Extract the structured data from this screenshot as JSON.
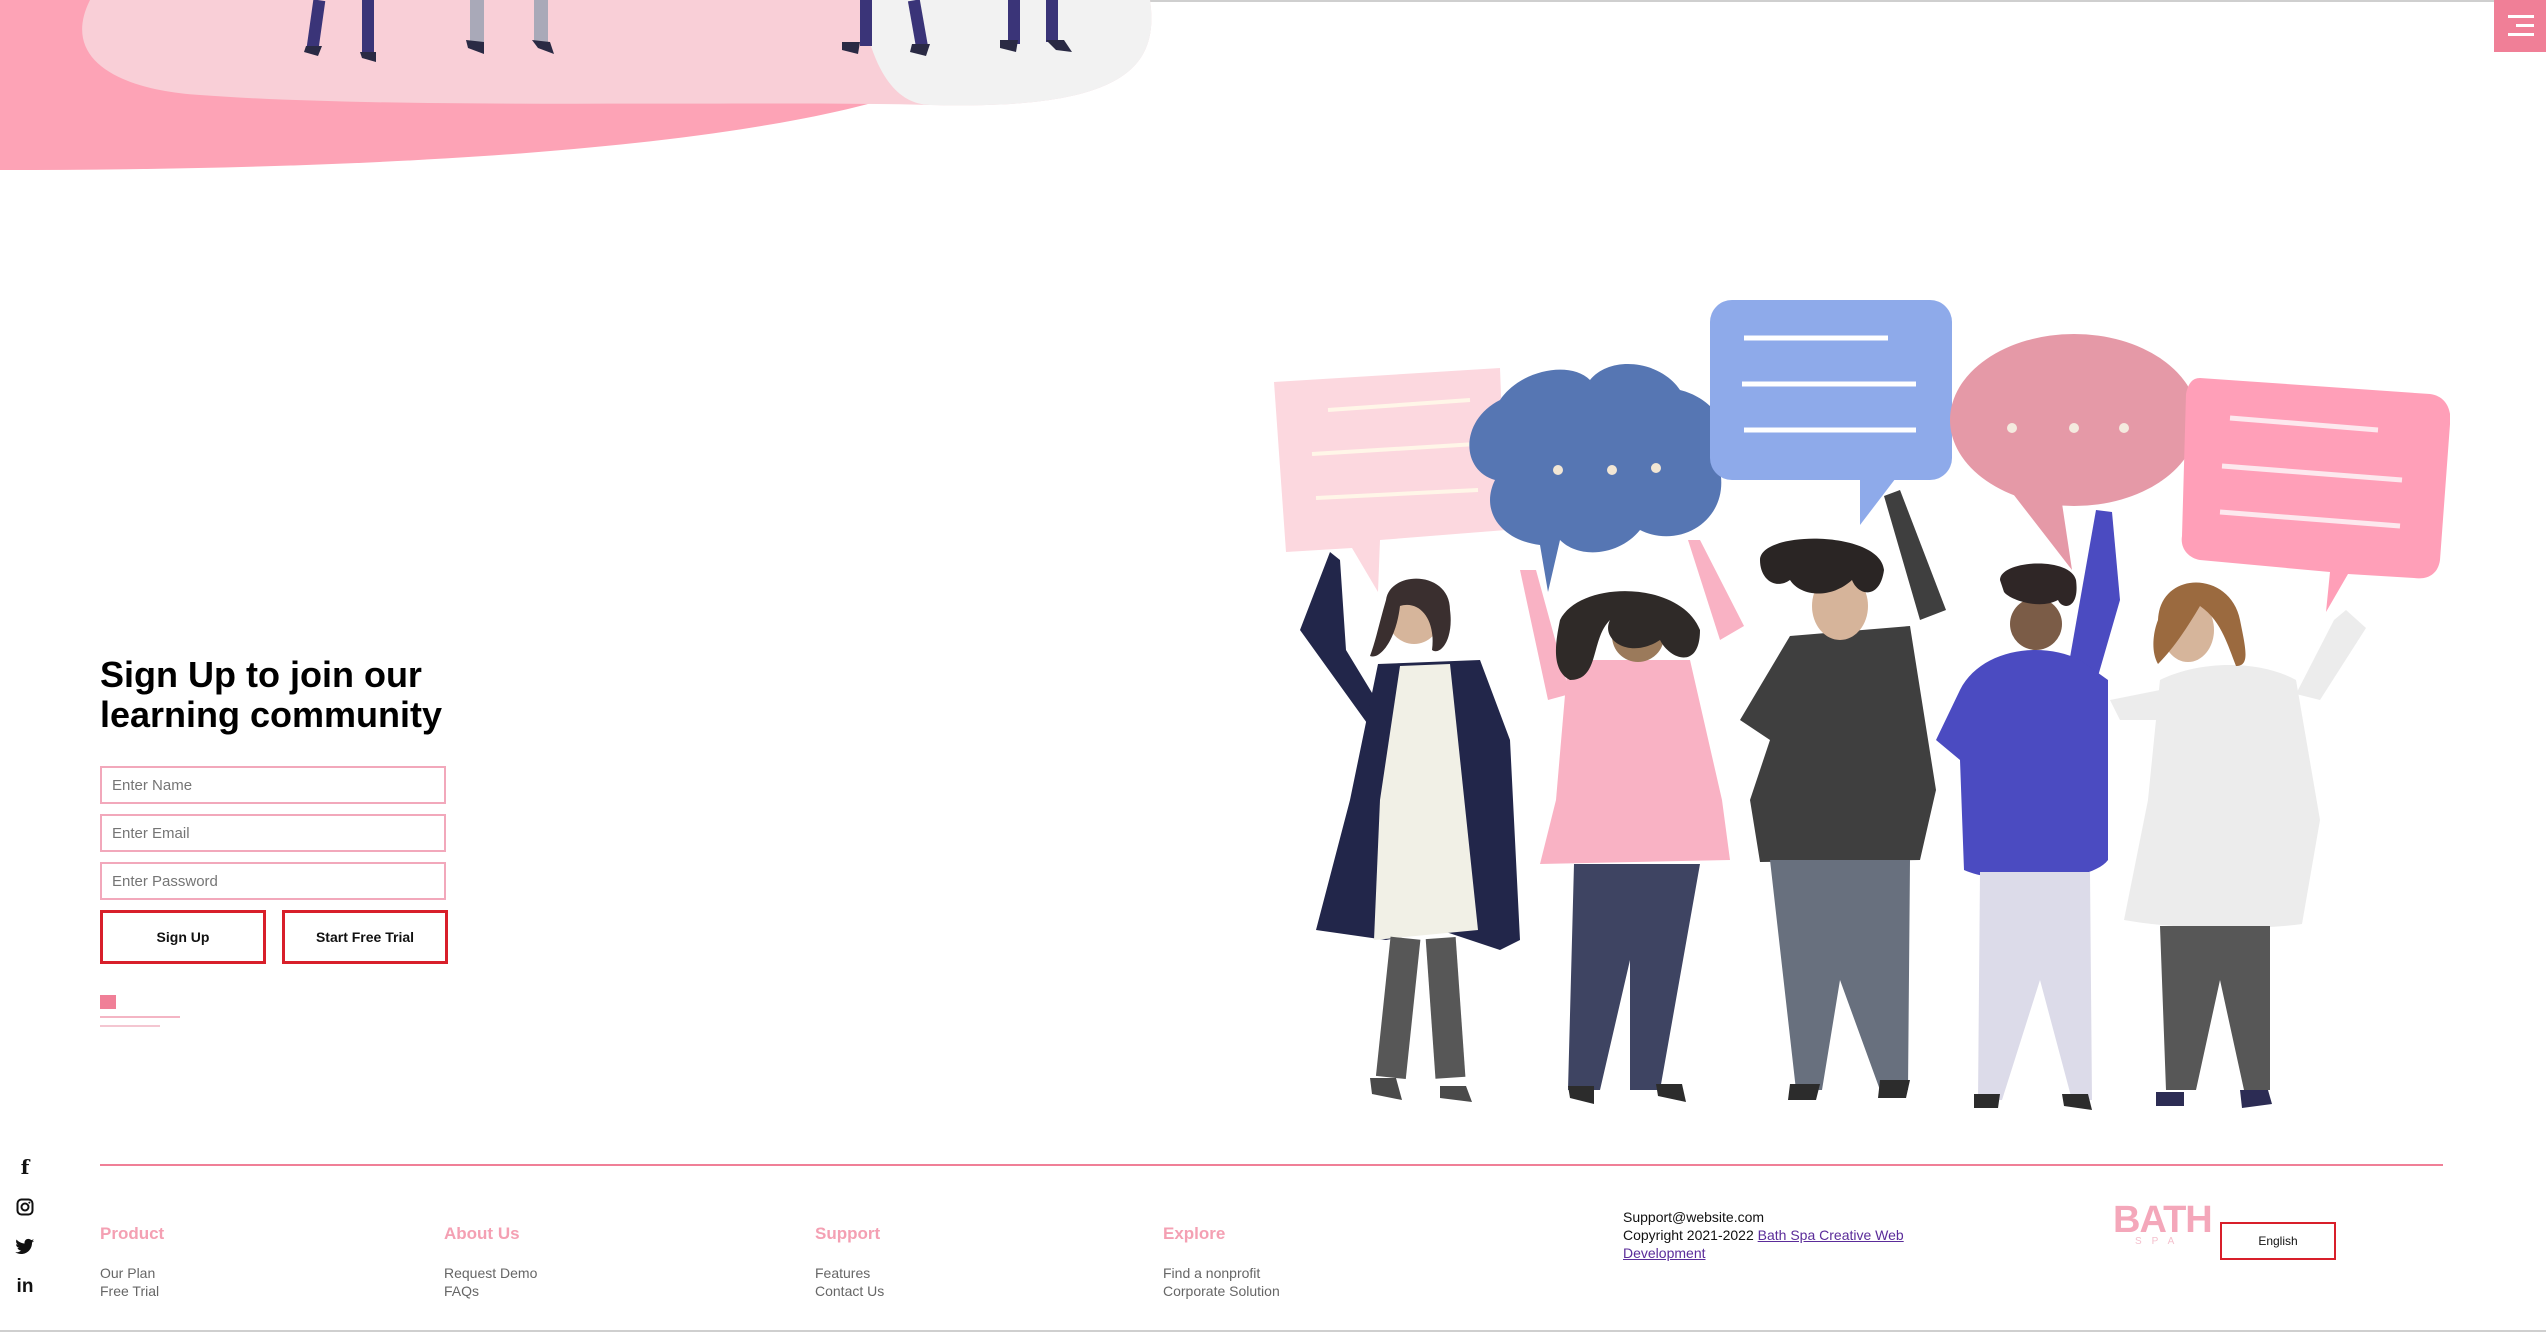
{
  "signup": {
    "title": "Sign Up to join our learning community",
    "name_placeholder": "Enter Name",
    "email_placeholder": "Enter Email",
    "password_placeholder": "Enter Password",
    "signup_label": "Sign Up",
    "trial_label": "Start Free Trial"
  },
  "social": [
    "facebook-icon",
    "instagram-icon",
    "twitter-icon",
    "linkedin-icon"
  ],
  "footer": {
    "product": {
      "heading": "Product",
      "links": [
        "Our Plan",
        "Free Trial"
      ]
    },
    "about": {
      "heading": "About Us",
      "links": [
        "Request Demo",
        "FAQs"
      ]
    },
    "support": {
      "heading": "Support",
      "links": [
        "Features",
        "Contact Us"
      ]
    },
    "explore": {
      "heading": "Explore",
      "links": [
        "Find a nonprofit",
        "Corporate Solution"
      ]
    },
    "contact": {
      "email": "Support@website.com",
      "copyright_prefix": "Copyright 2021-2022",
      "copyright_link": "Bath Spa Creative Web Development"
    },
    "logo_text": "BATH",
    "logo_sub": "SPA",
    "language": "English"
  },
  "colors": {
    "accent": "#f07f97",
    "border_red": "#d81f2a",
    "pink_light": "#f4a0b3"
  }
}
